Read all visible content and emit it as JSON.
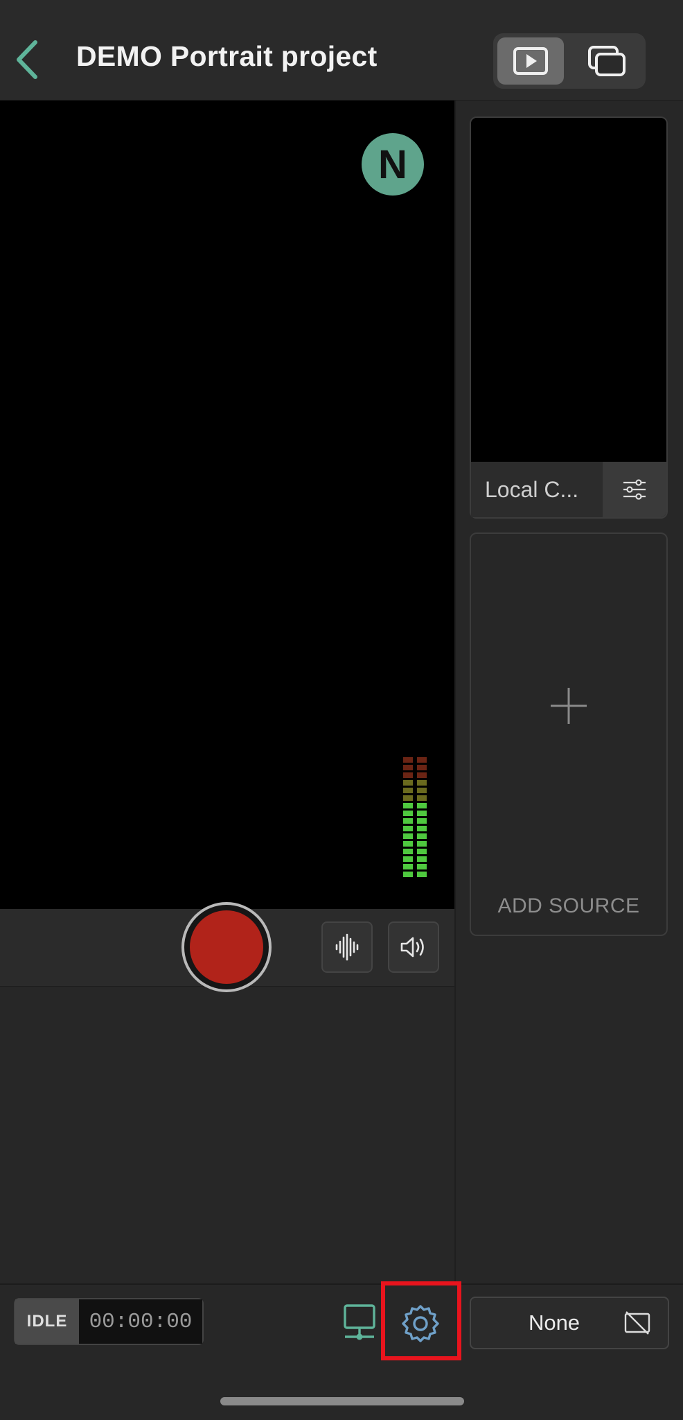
{
  "header": {
    "title": "DEMO Portrait project",
    "back_icon": "chevron-left-icon",
    "modes": [
      {
        "icon": "play-icon",
        "active": true
      },
      {
        "icon": "multi-window-icon",
        "active": false
      }
    ]
  },
  "preview": {
    "avatar_letter": "N",
    "avatar_color": "#5fa48c",
    "audio_meter": {
      "channels": 2,
      "level": 0.62
    }
  },
  "controls": {
    "record_icon": "record-icon",
    "record_color": "#b1231a",
    "waveform_icon": "waveform-icon",
    "speaker_icon": "speaker-icon"
  },
  "sources": {
    "items": [
      {
        "label": "Local C..."
      }
    ],
    "add_label": "ADD SOURCE"
  },
  "status": {
    "state": "IDLE",
    "timer": "00:00:00"
  },
  "destination": {
    "label": "None",
    "icon": "no-output-icon"
  },
  "colors": {
    "accent": "#5fb49a",
    "highlight": "#e8141d",
    "settings_icon": "#6fa0c8"
  }
}
